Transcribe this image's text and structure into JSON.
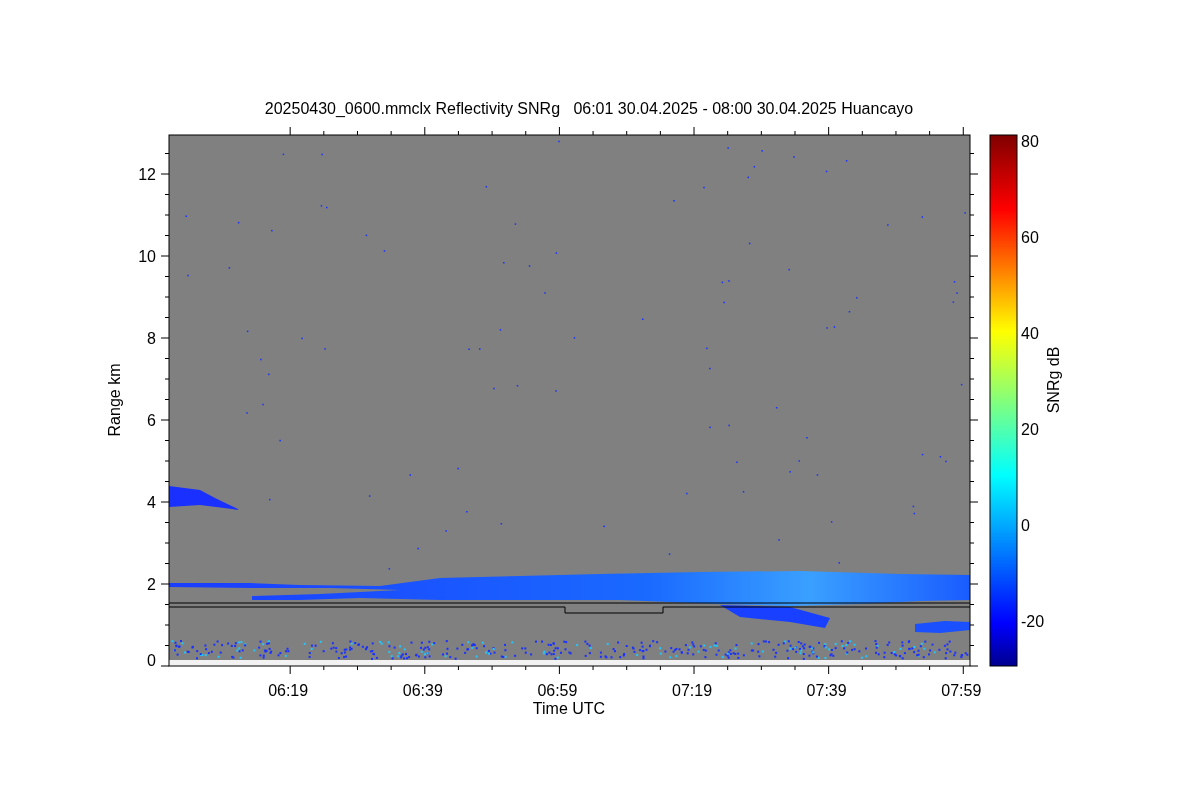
{
  "plot": {
    "title": "20250430_0600.mmclx Reflectivity SNRg   06:01 30.04.2025 - 08:00 30.04.2025 Huancayo",
    "ylabel": "Range km",
    "xlabel": "Time UTC",
    "yticks": [
      "12",
      "10",
      "8",
      "6",
      "4",
      "2",
      "0"
    ],
    "xticks": [
      "06:19",
      "06:39",
      "06:59",
      "07:19",
      "07:39",
      "07:59"
    ]
  },
  "colorbar": {
    "label": "SNRg dB",
    "ticks": [
      "80",
      "60",
      "40",
      "20",
      "0",
      "-20"
    ]
  }
}
